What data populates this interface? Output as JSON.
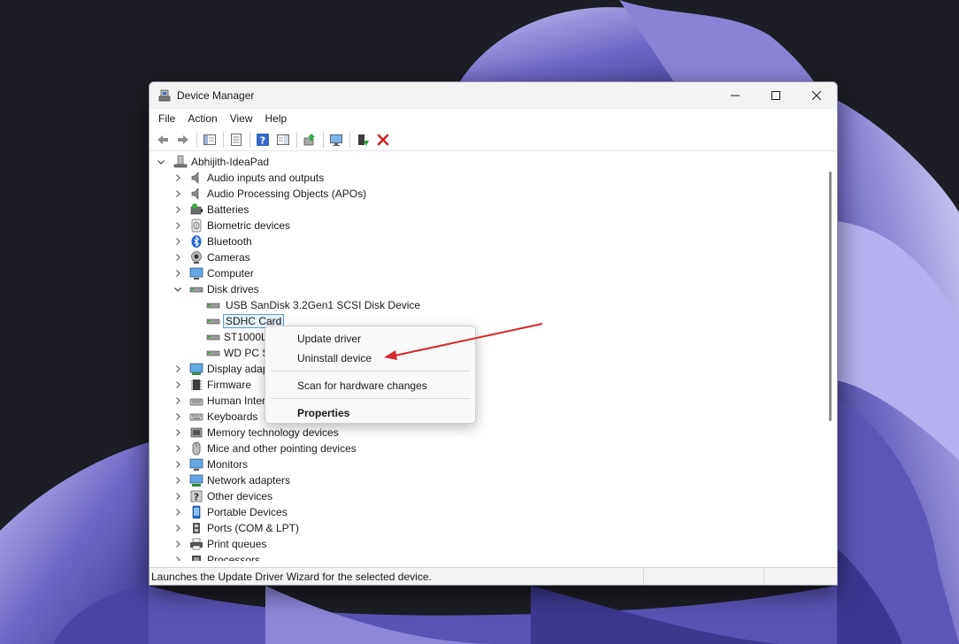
{
  "window": {
    "title": "Device Manager",
    "minimize_icon": "minimize-icon",
    "maximize_icon": "maximize-icon",
    "close_icon": "close-icon"
  },
  "menubar": {
    "items": [
      "File",
      "Action",
      "View",
      "Help"
    ]
  },
  "toolbar": {
    "buttons": [
      "back-arrow-icon",
      "forward-arrow-icon",
      "show-hide-console-tree-icon",
      "properties-sheet-icon",
      "help-icon",
      "action-pane-icon",
      "update-driver-icon",
      "scan-hardware-icon",
      "enable-device-icon",
      "uninstall-device-icon"
    ]
  },
  "tree": {
    "root": "Abhijith-IdeaPad",
    "categories": [
      {
        "label": "Audio inputs and outputs",
        "icon": "speaker-icon"
      },
      {
        "label": "Audio Processing Objects (APOs)",
        "icon": "speaker-icon"
      },
      {
        "label": "Batteries",
        "icon": "battery-icon"
      },
      {
        "label": "Biometric devices",
        "icon": "fingerprint-icon"
      },
      {
        "label": "Bluetooth",
        "icon": "bluetooth-icon"
      },
      {
        "label": "Cameras",
        "icon": "camera-icon"
      },
      {
        "label": "Computer",
        "icon": "monitor-icon"
      },
      {
        "label": "Disk drives",
        "icon": "disk-drive-icon",
        "expanded": true
      },
      {
        "label": "Display adap",
        "icon": "display-adapter-icon"
      },
      {
        "label": "Firmware",
        "icon": "firmware-icon"
      },
      {
        "label": "Human Inter",
        "icon": "hid-icon"
      },
      {
        "label": "Keyboards",
        "icon": "keyboard-icon"
      },
      {
        "label": "Memory technology devices",
        "icon": "memory-icon"
      },
      {
        "label": "Mice and other pointing devices",
        "icon": "mouse-icon"
      },
      {
        "label": "Monitors",
        "icon": "monitor-icon"
      },
      {
        "label": "Network adapters",
        "icon": "network-icon"
      },
      {
        "label": "Other devices",
        "icon": "unknown-device-icon"
      },
      {
        "label": "Portable Devices",
        "icon": "portable-device-icon"
      },
      {
        "label": "Ports (COM & LPT)",
        "icon": "port-icon"
      },
      {
        "label": "Print queues",
        "icon": "printer-icon"
      },
      {
        "label": "Processors",
        "icon": "processor-icon"
      }
    ],
    "disk_drives_children": [
      {
        "label": "USB  SanDisk 3.2Gen1 SCSI Disk Device",
        "selected": false
      },
      {
        "label": "SDHC Card",
        "selected": true
      },
      {
        "label": "ST1000LM",
        "selected": false
      },
      {
        "label": "WD PC S",
        "selected": false
      }
    ]
  },
  "context_menu": {
    "update_driver": "Update driver",
    "uninstall_device": "Uninstall device",
    "scan_hardware": "Scan for hardware changes",
    "properties": "Properties"
  },
  "status_bar": {
    "text": "Launches the Update Driver Wizard for the selected device."
  },
  "colors": {
    "annotation_arrow": "#d42a2a",
    "selection_border": "#5e9ad6",
    "selection_fill": "#e7f1fb"
  }
}
